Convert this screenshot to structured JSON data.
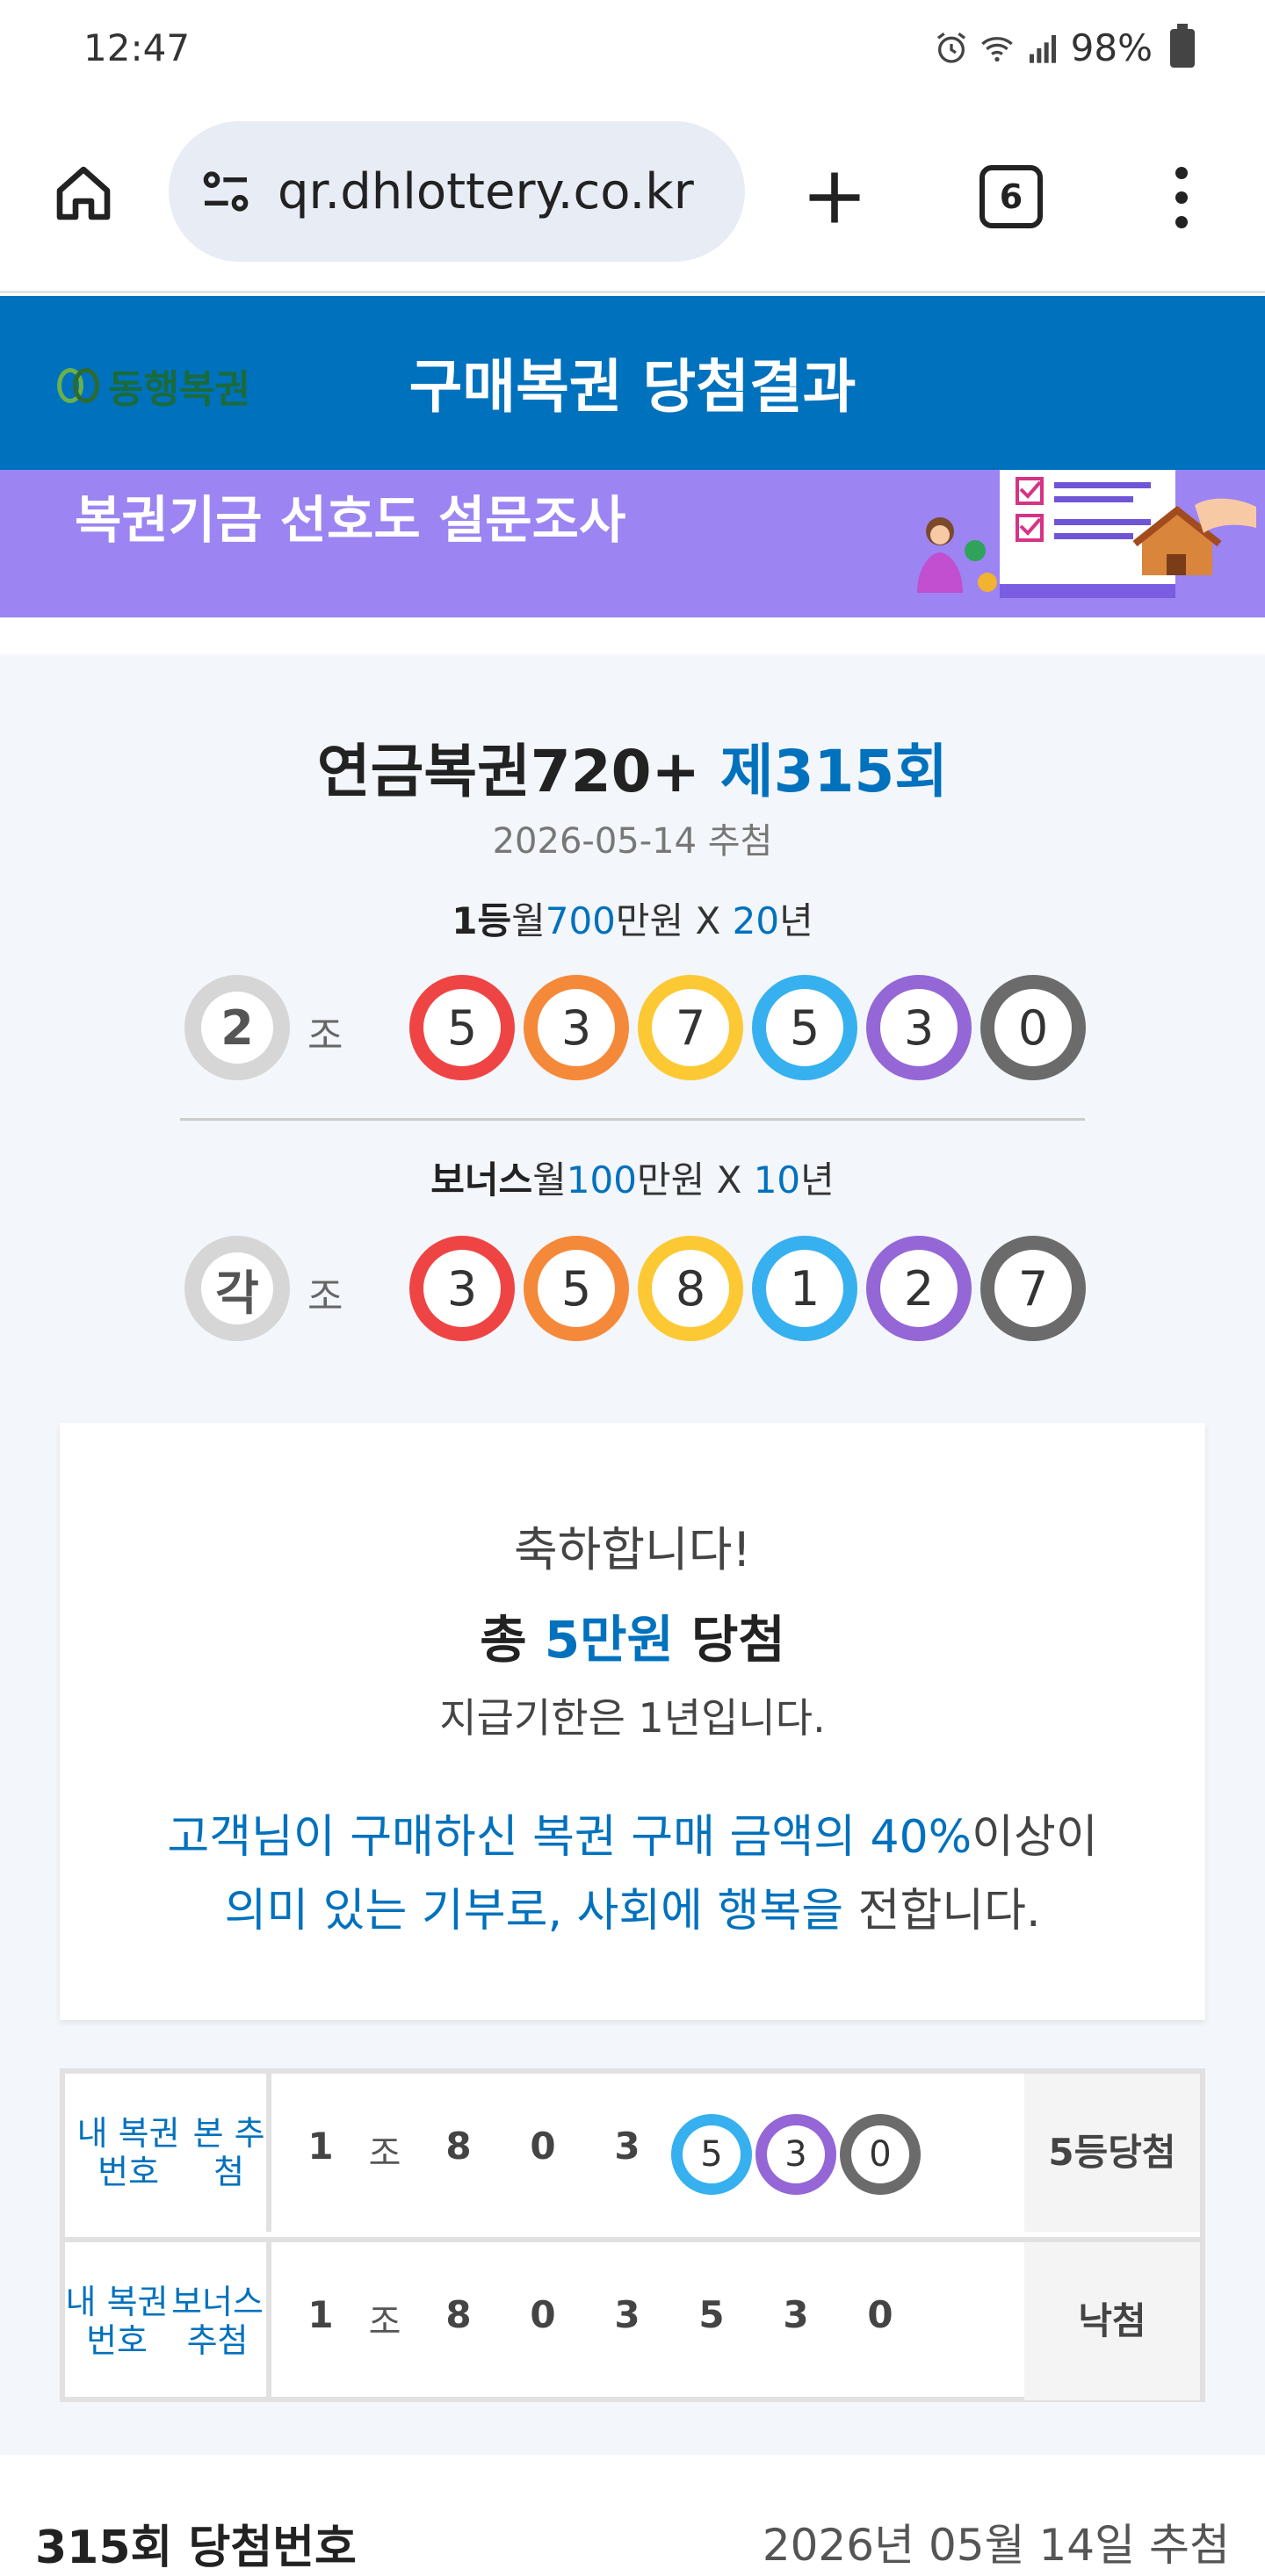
{
  "status_bar": {
    "time": "12:47",
    "battery": "98%"
  },
  "browser": {
    "url": "qr.dhlottery.co.kr",
    "tab_count": "6"
  },
  "header": {
    "logo_text": "동행복권",
    "title": "구매복권 당첨결과"
  },
  "banner": {
    "text": "복권기금 선호도 설문조사"
  },
  "draw": {
    "title_main": "연금복권720+ ",
    "title_round": "제315회",
    "date": "2026-05-14 추첨",
    "first_prize": {
      "rank": "1등",
      "pre": "월",
      "amount": "700",
      "mid": "만원 X ",
      "years": "20",
      "post": "년"
    },
    "first_group": "2",
    "first_numbers": [
      "5",
      "3",
      "7",
      "5",
      "3",
      "0"
    ],
    "bonus_prize": {
      "rank": "보너스",
      "pre": "월",
      "amount": "100",
      "mid": "만원 X ",
      "years": "10",
      "post": "년"
    },
    "bonus_group": "각",
    "bonus_numbers": [
      "3",
      "5",
      "8",
      "1",
      "2",
      "7"
    ],
    "jo_label": "조",
    "ball_colors": [
      "#ef4444",
      "#f5893a",
      "#fcc934",
      "#36b0ef",
      "#9466d6",
      "#6b6b6b"
    ]
  },
  "result": {
    "congrats": "축하합니다!",
    "total_pre": "총 ",
    "total_amount": "5만원",
    "total_post": " 당첨",
    "deadline": "지급기한은 1년입니다.",
    "donation_line1_blue": "고객님이 구매하신 복권 구매 금액의 40%",
    "donation_line1_rest": "이상이",
    "donation_line2_blue": "의미 있는 기부로, 사회에 행복을",
    "donation_line2_rest": " 전합니다."
  },
  "tickets": [
    {
      "label_line1": "내 복권 번호",
      "label_line2": "본 추첨",
      "group": "1",
      "jo": "조",
      "numbers": [
        "8",
        "0",
        "3",
        "5",
        "3",
        "0"
      ],
      "matched_from_index": 3,
      "result_line1": "5등",
      "result_line2": "당첨"
    },
    {
      "label_line1": "내 복권 번호",
      "label_line2": "보너스 추첨",
      "group": "1",
      "jo": "조",
      "numbers": [
        "8",
        "0",
        "3",
        "5",
        "3",
        "0"
      ],
      "matched_from_index": 6,
      "result_line1": "낙첨",
      "result_line2": ""
    }
  ],
  "footer": {
    "title": "315회 당첨번호",
    "date": "2026년 05월 14일 추첨"
  }
}
